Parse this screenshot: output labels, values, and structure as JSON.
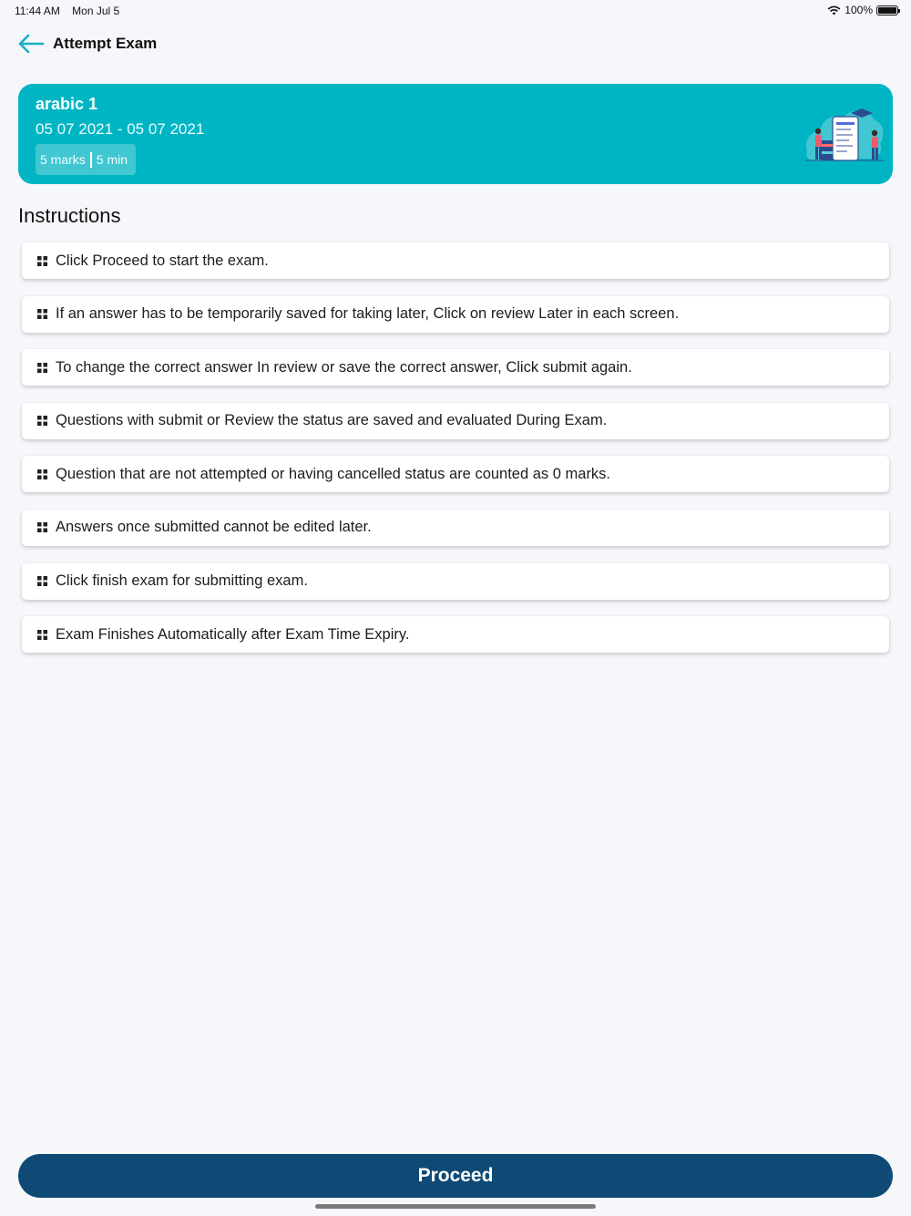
{
  "status_bar": {
    "time": "11:44 AM",
    "date": "Mon Jul 5",
    "battery": "100%"
  },
  "header": {
    "title": "Attempt Exam",
    "back_icon": "arrow-left-icon"
  },
  "exam": {
    "name": "arabic 1",
    "dates": "05 07 2021 - 05 07 2021",
    "marks": "5 marks",
    "duration": "5 min"
  },
  "instructions": {
    "title": "Instructions",
    "items": [
      "Click Proceed to start the exam.",
      "If an answer has to be temporarily saved for taking later, Click on review Later in each screen.",
      "To change the correct answer In review or save the correct answer, Click submit again.",
      "Questions with submit or Review the status are saved and evaluated During Exam.",
      "Question that are not attempted or having cancelled status are counted as 0 marks.",
      "Answers once submitted cannot be edited later.",
      "Click finish exam for submitting exam.",
      "Exam Finishes Automatically after Exam Time Expiry."
    ]
  },
  "proceed_label": "Proceed",
  "colors": {
    "card": "#00b5c3",
    "button": "#0e4a75",
    "accent": "#1bb0bf"
  }
}
